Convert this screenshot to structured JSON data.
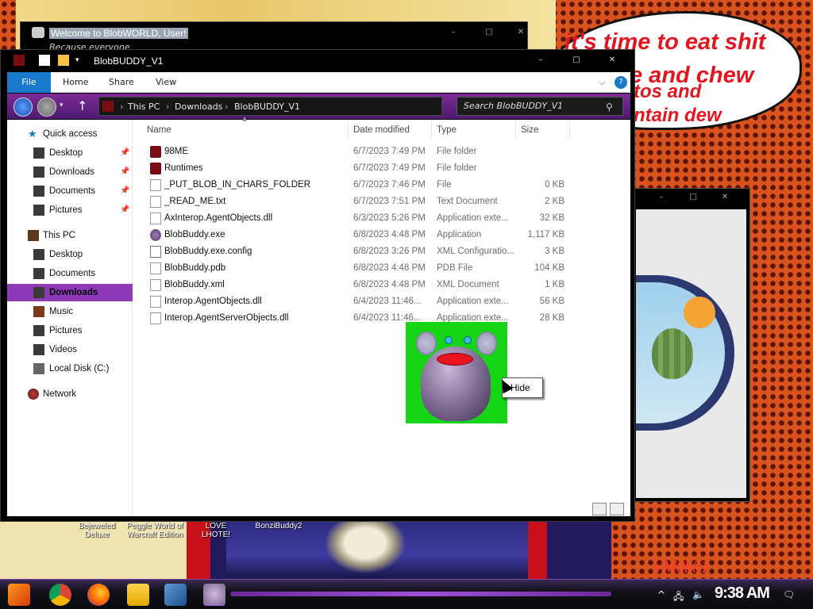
{
  "desktop": {
    "speech_lines": [
      "it's time to eat shit",
      "e and chew",
      "tos and",
      "ntain dew"
    ],
    "icon_labels": [
      "Bejeweled Deluxe",
      "Peggle World of Warcraft Edition",
      "LOVE LHOTE!",
      "BonziBuddy2"
    ],
    "watermark": "VM0b01"
  },
  "back_window": {
    "title": "Welcome to BlobWORLD, User!",
    "subtitle": "Because everyone"
  },
  "explorer": {
    "title": "BlobBUDDY_V1",
    "ribbon_tabs": [
      "File",
      "Home",
      "Share",
      "View"
    ],
    "breadcrumb": [
      "This PC",
      "Downloads",
      "BlobBUDDY_V1"
    ],
    "search_placeholder": "Search BlobBUDDY_V1",
    "nav": [
      {
        "label": "Quick access",
        "icon": "star-icon"
      },
      {
        "label": "Desktop",
        "icon": "desktop-icon",
        "pinned": true
      },
      {
        "label": "Downloads",
        "icon": "downloads-icon",
        "pinned": true
      },
      {
        "label": "Documents",
        "icon": "documents-icon",
        "pinned": true
      },
      {
        "label": "Pictures",
        "icon": "pictures-icon",
        "pinned": true
      },
      {
        "label": "This PC",
        "icon": "computer-icon"
      },
      {
        "label": "Desktop",
        "icon": "desktop-icon"
      },
      {
        "label": "Documents",
        "icon": "documents-icon"
      },
      {
        "label": "Downloads",
        "icon": "downloads-icon",
        "selected": true
      },
      {
        "label": "Music",
        "icon": "music-icon"
      },
      {
        "label": "Pictures",
        "icon": "pictures-icon"
      },
      {
        "label": "Videos",
        "icon": "videos-icon"
      },
      {
        "label": "Local Disk (C:)",
        "icon": "disk-icon"
      },
      {
        "label": "Network",
        "icon": "network-icon"
      }
    ],
    "columns": [
      "Name",
      "Date modified",
      "Type",
      "Size"
    ],
    "files": [
      {
        "name": "98ME",
        "date": "6/7/2023 7:49 PM",
        "type": "File folder",
        "size": "",
        "icon": "folder-icon"
      },
      {
        "name": "Runtimes",
        "date": "6/7/2023 7:49 PM",
        "type": "File folder",
        "size": "",
        "icon": "folder-icon"
      },
      {
        "name": "_PUT_BLOB_IN_CHARS_FOLDER",
        "date": "6/7/2023 7:46 PM",
        "type": "File",
        "size": "0 KB",
        "icon": "file-icon"
      },
      {
        "name": "_READ_ME.txt",
        "date": "6/7/2023 7:51 PM",
        "type": "Text Document",
        "size": "2 KB",
        "icon": "text-file-icon"
      },
      {
        "name": "AxInterop.AgentObjects.dll",
        "date": "6/3/2023 5:26 PM",
        "type": "Application exte...",
        "size": "32 KB",
        "icon": "dll-icon"
      },
      {
        "name": "BlobBuddy.exe",
        "date": "6/8/2023 4:48 PM",
        "type": "Application",
        "size": "1,117 KB",
        "icon": "blob-exe-icon"
      },
      {
        "name": "BlobBuddy.exe.config",
        "date": "6/8/2023 3:26 PM",
        "type": "XML Configuratio...",
        "size": "3 KB",
        "icon": "config-icon"
      },
      {
        "name": "BlobBuddy.pdb",
        "date": "6/8/2023 4:48 PM",
        "type": "PDB File",
        "size": "104 KB",
        "icon": "file-icon"
      },
      {
        "name": "BlobBuddy.xml",
        "date": "6/8/2023 4:48 PM",
        "type": "XML Document",
        "size": "1 KB",
        "icon": "xml-icon"
      },
      {
        "name": "Interop.AgentObjects.dll",
        "date": "6/4/2023 11:46...",
        "type": "Application exte...",
        "size": "56 KB",
        "icon": "dll-icon"
      },
      {
        "name": "Interop.AgentServerObjects.dll",
        "date": "6/4/2023 11:46...",
        "type": "Application exte...",
        "size": "28 KB",
        "icon": "dll-icon"
      }
    ]
  },
  "agent": {
    "menu_item": "Hide"
  },
  "taskbar": {
    "clock": "9:38 AM",
    "apps": [
      "start-icon",
      "chrome-icon",
      "firefox-icon",
      "file-explorer-icon",
      "virtualbox-icon",
      "blobbuddy-icon"
    ]
  },
  "colors": {
    "accent": "#8e3ab8",
    "file_tab": "#1979ca",
    "speech_text": "#e1161e",
    "agent_bg": "#16d416"
  }
}
